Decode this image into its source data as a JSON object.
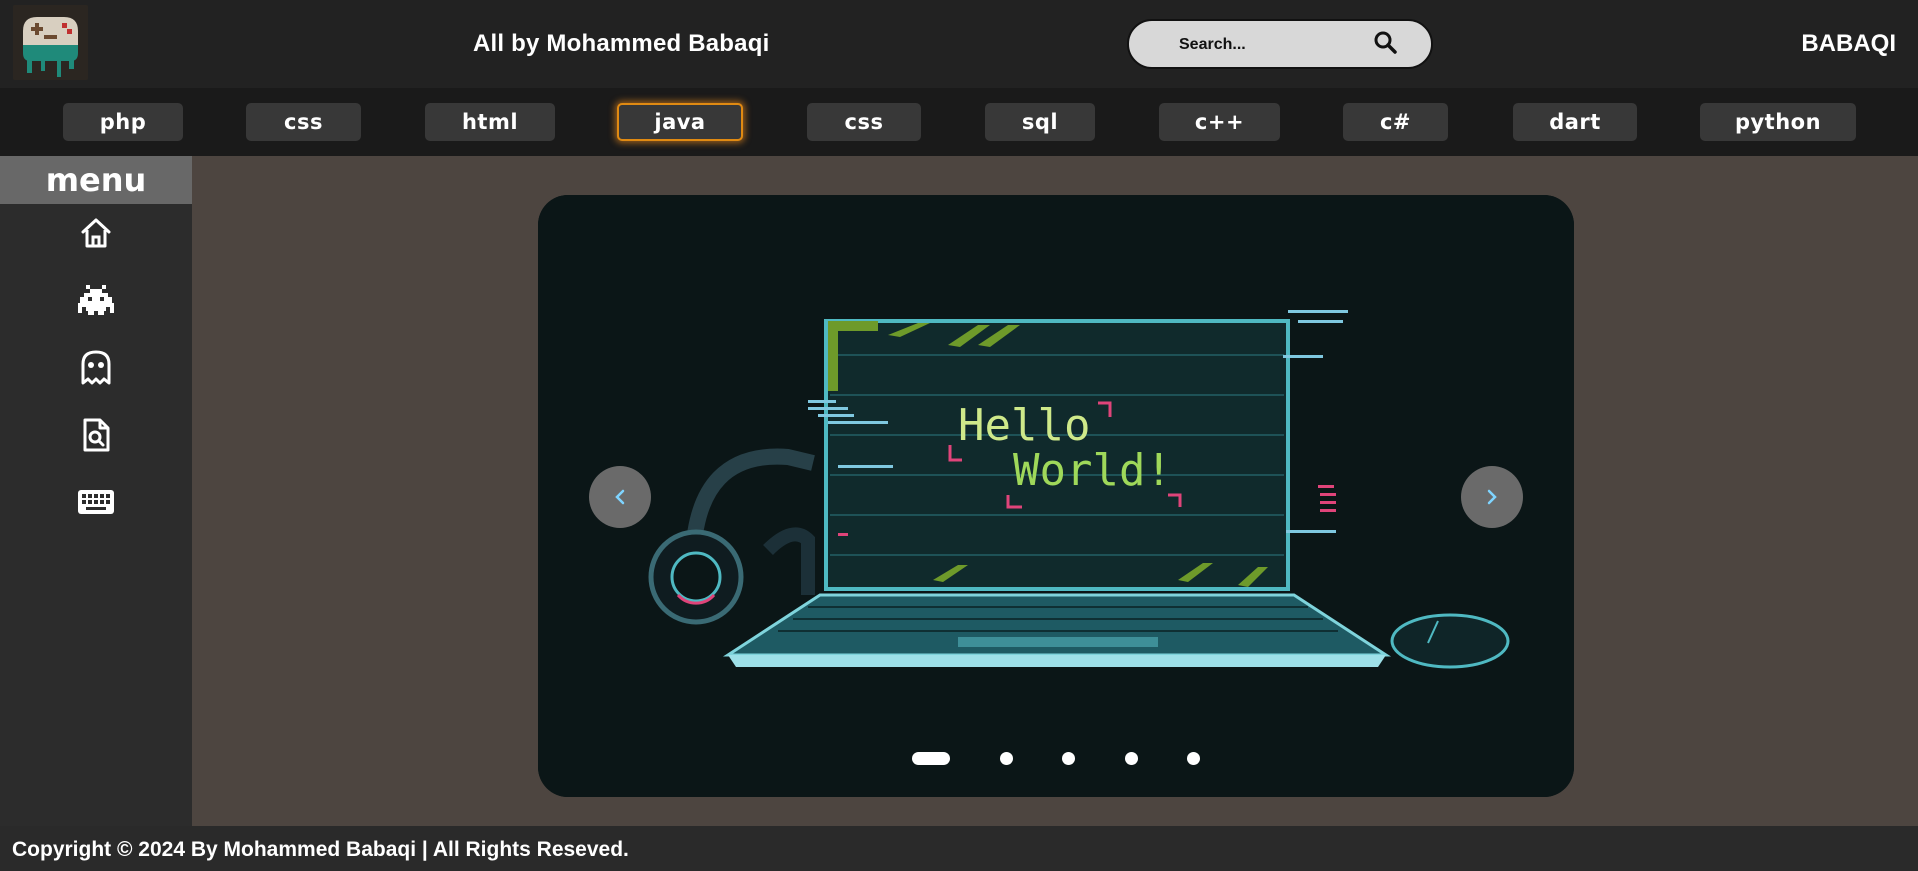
{
  "header": {
    "title": "All by Mohammed Babaqi",
    "brand": "BABAQI",
    "search": {
      "placeholder": "Search..."
    }
  },
  "tabs": [
    {
      "label": "php",
      "active": false
    },
    {
      "label": "css",
      "active": false
    },
    {
      "label": "html",
      "active": false
    },
    {
      "label": "java",
      "active": true
    },
    {
      "label": "css",
      "active": false
    },
    {
      "label": "sql",
      "active": false
    },
    {
      "label": "c++",
      "active": false
    },
    {
      "label": "c#",
      "active": false
    },
    {
      "label": "dart",
      "active": false
    },
    {
      "label": "python",
      "active": false
    }
  ],
  "sidebar": {
    "title": "menu",
    "icons": [
      "home-icon",
      "space-invader-icon",
      "ghost-icon",
      "file-search-icon",
      "keyboard-icon"
    ]
  },
  "slider": {
    "slide_text_line1": "Hello",
    "slide_text_line2": "World!",
    "prev_icon": "chevron-left-icon",
    "next_icon": "chevron-right-icon",
    "total_slides": 5,
    "active_slide": 1
  },
  "footer": {
    "copyright": "Copyright © 2024 By Mohammed Babaqi | All Rights Reseved."
  },
  "colors": {
    "header_bg": "#222222",
    "tabs_bg": "#1a1a1a",
    "tab_bg": "#383838",
    "tab_active_glow": "#e08a12",
    "sidebar_bg": "#2c2c2c",
    "menu_title_bg": "#686868",
    "content_bg": "#4d4540",
    "slider_bg": "#0c1618"
  }
}
